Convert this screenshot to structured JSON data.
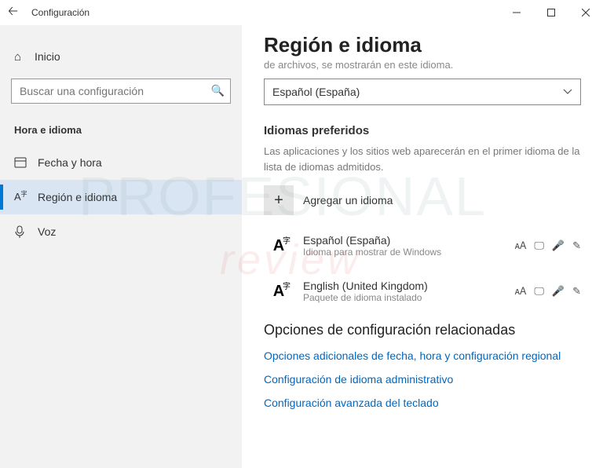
{
  "titlebar": {
    "title": "Configuración"
  },
  "sidebar": {
    "home": "Inicio",
    "search_placeholder": "Buscar una configuración",
    "category": "Hora e idioma",
    "items": [
      {
        "label": "Fecha y hora"
      },
      {
        "label": "Región e idioma"
      },
      {
        "label": "Voz"
      }
    ]
  },
  "main": {
    "title": "Región e idioma",
    "truncated_line": "de archivos, se mostrarán en este idioma.",
    "display_language": "Español (España)",
    "preferred": {
      "title": "Idiomas preferidos",
      "desc": "Las aplicaciones y los sitios web aparecerán en el primer idioma de la lista de idiomas admitidos.",
      "add": "Agregar un idioma",
      "langs": [
        {
          "name": "Español (España)",
          "sub": "Idioma para mostrar de Windows"
        },
        {
          "name": "English (United Kingdom)",
          "sub": "Paquete de idioma instalado"
        }
      ]
    },
    "related": {
      "title": "Opciones de configuración relacionadas",
      "links": [
        "Opciones adicionales de fecha, hora y configuración regional",
        "Configuración de idioma administrativo",
        "Configuración avanzada del teclado"
      ]
    }
  },
  "watermark": {
    "line1": "PROFESIONAL",
    "line2": "review"
  }
}
